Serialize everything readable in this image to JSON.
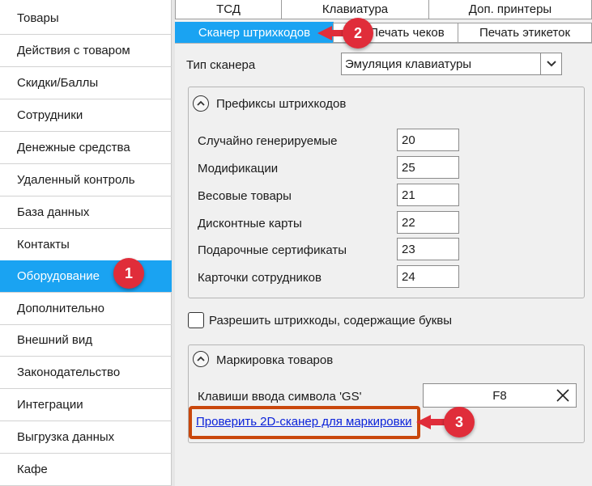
{
  "sidebar": {
    "items": [
      {
        "label": "Товары"
      },
      {
        "label": "Действия с товаром"
      },
      {
        "label": "Скидки/Баллы"
      },
      {
        "label": "Сотрудники"
      },
      {
        "label": "Денежные средства"
      },
      {
        "label": "Удаленный контроль"
      },
      {
        "label": "База данных"
      },
      {
        "label": "Контакты"
      },
      {
        "label": "Оборудование",
        "active": true
      },
      {
        "label": "Дополнительно"
      },
      {
        "label": "Внешний вид"
      },
      {
        "label": "Законодательство"
      },
      {
        "label": "Интеграции"
      },
      {
        "label": "Выгрузка данных"
      },
      {
        "label": "Кафе"
      }
    ]
  },
  "tabs": {
    "row1": [
      "ТСД",
      "Клавиатура",
      "Доп. принтеры"
    ],
    "row2": [
      "Сканер штрихкодов",
      "Печать чеков",
      "Печать этикеток"
    ],
    "selected": "Сканер штрихкодов"
  },
  "scanner_type": {
    "label": "Тип сканера",
    "value": "Эмуляция клавиатуры"
  },
  "prefixes": {
    "title": "Префиксы штрихкодов",
    "rows": [
      {
        "label": "Случайно генерируемые",
        "value": "20"
      },
      {
        "label": "Модификации",
        "value": "25"
      },
      {
        "label": "Весовые товары",
        "value": "21"
      },
      {
        "label": "Дисконтные карты",
        "value": "22"
      },
      {
        "label": "Подарочные сертификаты",
        "value": "23"
      },
      {
        "label": "Карточки сотрудников",
        "value": "24"
      }
    ]
  },
  "allow_letters": {
    "label": "Разрешить штрихкоды, содержащие буквы",
    "checked": false
  },
  "marking": {
    "title": "Маркировка товаров",
    "gs_label": "Клавиши ввода символа 'GS'",
    "gs_value": "F8",
    "check_link": "Проверить 2D-сканер для маркировки"
  },
  "annotations": {
    "markers": [
      "1",
      "2",
      "3"
    ],
    "color": "#e02d3a"
  },
  "colors": {
    "accent": "#1aa3f2",
    "link": "#0b22d9",
    "highlight": "#c9470c"
  }
}
